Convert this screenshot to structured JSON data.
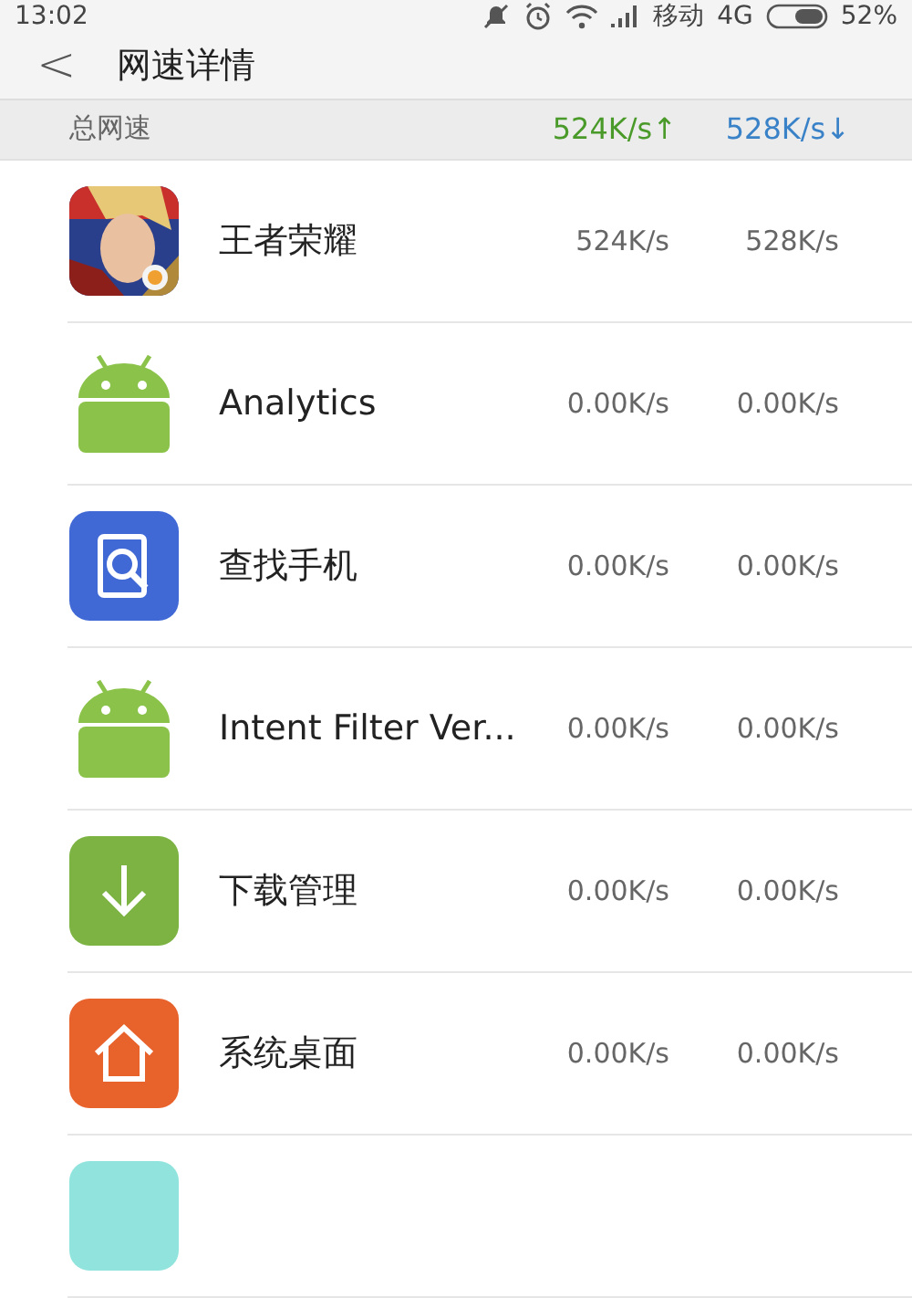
{
  "status_bar": {
    "time": "13:02",
    "carrier": "移动",
    "network": "4G",
    "battery": "52%"
  },
  "header": {
    "back": "<",
    "title": "网速详情"
  },
  "summary": {
    "label": "总网速",
    "upload": "524K/s↑",
    "download": "528K/s↓"
  },
  "apps": [
    {
      "kind": "picture",
      "name": "王者荣耀",
      "upload": "524K/s",
      "download": "528K/s"
    },
    {
      "kind": "android",
      "name": "Analytics",
      "upload": "0.00K/s",
      "download": "0.00K/s"
    },
    {
      "kind": "search",
      "name": "查找手机",
      "upload": "0.00K/s",
      "download": "0.00K/s"
    },
    {
      "kind": "android",
      "name": "Intent Filter Ver...",
      "upload": "0.00K/s",
      "download": "0.00K/s"
    },
    {
      "kind": "download",
      "name": "下载管理",
      "upload": "0.00K/s",
      "download": "0.00K/s"
    },
    {
      "kind": "home",
      "name": "系统桌面",
      "upload": "0.00K/s",
      "download": "0.00K/s"
    },
    {
      "kind": "blank"
    }
  ]
}
